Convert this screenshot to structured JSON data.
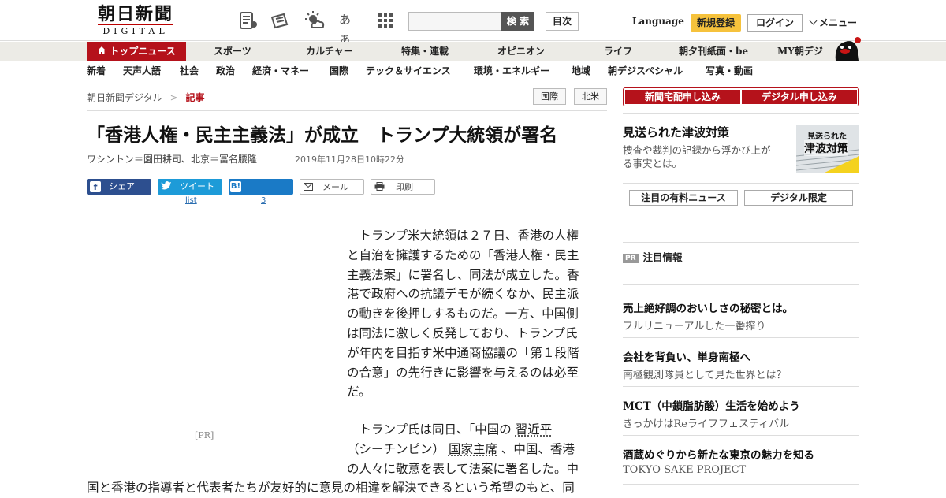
{
  "logo": {
    "main": "朝日新聞",
    "sub": "DIGITAL"
  },
  "header": {
    "icon_names": [
      "newspaper-reader-icon",
      "notice-icon",
      "weather-icon",
      "font-size-icon",
      "grid-menu-icon"
    ],
    "font_glyph": "あぁ",
    "search_placeholder": "",
    "search_label": "検 索",
    "toc_label": "目次",
    "language_label": "Language",
    "register_label": "新規登録",
    "login_label": "ログイン",
    "menu_label": "メニュー"
  },
  "nav_primary": [
    {
      "label": "トップニュース"
    },
    {
      "label": "スポーツ"
    },
    {
      "label": "カルチャー"
    },
    {
      "label": "特集・連載"
    },
    {
      "label": "オピニオン"
    },
    {
      "label": "ライフ"
    },
    {
      "label": "朝夕刊紙面・be"
    },
    {
      "label": "MY朝デジ"
    }
  ],
  "nav_secondary": [
    {
      "label": "新着"
    },
    {
      "label": "天声人語"
    },
    {
      "label": "社会"
    },
    {
      "label": "政治"
    },
    {
      "label": "経済・マネー"
    },
    {
      "label": "国際"
    },
    {
      "label": "テック＆サイエンス"
    },
    {
      "label": "環境・エネルギー"
    },
    {
      "label": "地域"
    },
    {
      "label": "朝デジスペシャル"
    },
    {
      "label": "写真・動画"
    }
  ],
  "breadcrumb": {
    "home": "朝日新聞デジタル",
    "separator": ">",
    "current": "記事"
  },
  "tags": [
    "国際",
    "北米"
  ],
  "article": {
    "title": "「香港人権・民主主義法」が成立　トランプ大統領が署名",
    "byline": "ワシントン＝園田耕司、北京＝冨名腰隆",
    "date": "2019年11月28日10時22分",
    "share": {
      "facebook": "シェア",
      "twitter": "ツイート",
      "twitter_count": "list",
      "hatena": "ブックマーク",
      "hatena_count": "3",
      "mail": "メール",
      "print": "印刷"
    },
    "ad_label": "[PR]",
    "p1_lines": [
      "トランプ米大統領は２７日、香港の人権",
      "と自治を擁護するための「香港人権・民主",
      "主義法案」に署名し、同法が成立した。香",
      "港で政府への抗議デモが続くなか、民主派",
      "の動きを後押しするものだ。一方、中国側",
      "は同法に激しく反発しており、トランプ氏",
      "が年内を目指す米中通商協議の「第１段階",
      "の合意」の先行きに影響を与えるのは必至",
      "だ。"
    ],
    "p2": {
      "lead": "トランプ氏は同日、「中国の",
      "link1": "習近平",
      "paren": "（シーチンピン）",
      "link2": "国家主席",
      "rest1": "、中国、香港",
      "line3": "の人々に敬意を表して法案に署名した。中",
      "line4": "国と香港の指導者と代表者たちが友好的に意見の相違を解決できるという希望のもと、同"
    }
  },
  "sidebar": {
    "apply_paper": "新聞宅配申し込み",
    "apply_digital": "デジタル申し込み",
    "feature": {
      "title": "見送られた津波対策",
      "desc_lines": [
        "捜査や裁判の記録から浮かび上が",
        "る事実とは。"
      ],
      "thumb_text_1": "見送られた",
      "thumb_text_2": "津波対策"
    },
    "paid_news": "注目の有料ニュース",
    "digital_only": "デジタル限定",
    "pr_badge": "PR",
    "pr_title": "注目情報",
    "pr_items": [
      {
        "title": "売上絶好調のおいしさの秘密とは。",
        "sub": "フルリニューアルした一番搾り"
      },
      {
        "title": "会社を背負い、単身南極へ",
        "sub": "南極観測隊員として見た世界とは？"
      },
      {
        "title": "MCT（中鎖脂肪酸）生活を始めよう",
        "sub": "きっかけはReライフフェスティバル"
      },
      {
        "title": "酒蔵めぐりから新たな東京の魅力を知る",
        "sub": "TOKYO SAKE PROJECT"
      }
    ]
  },
  "colors": {
    "brand_red": "#b5121b",
    "register_yellow": "#f6c23c",
    "facebook": "#2d4f8f",
    "twitter": "#1d9bd8",
    "hatena": "#1a7ac6"
  }
}
